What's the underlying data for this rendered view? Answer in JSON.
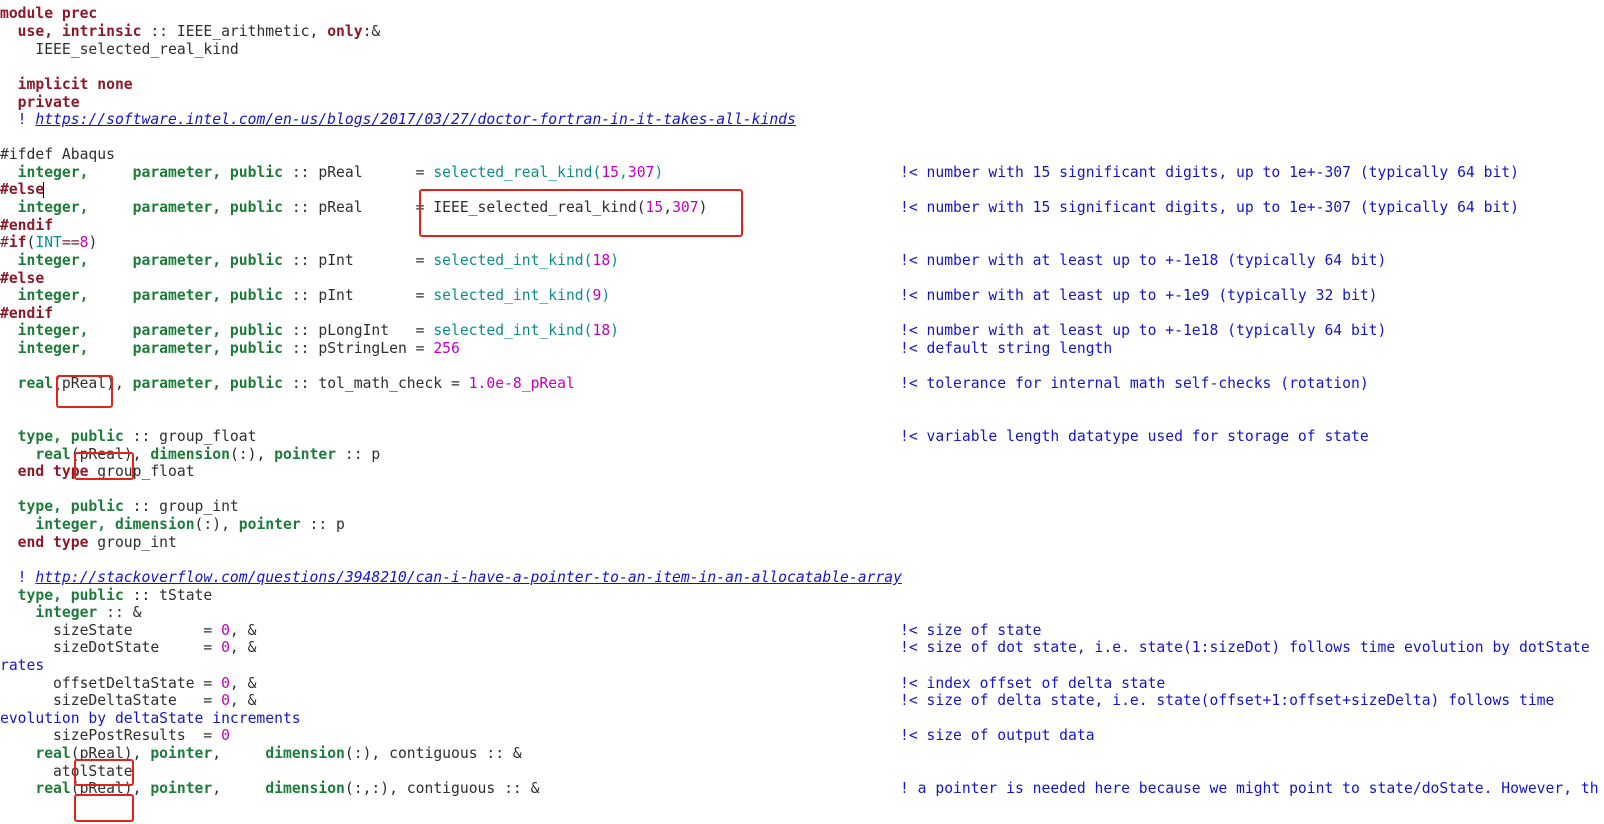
{
  "editor": {
    "lines": {
      "l01": "module prec",
      "l02a": "  use, intrinsic",
      "l02b": " :: IEEE_arithmetic, ",
      "l02c": "only",
      "l02d": ":&",
      "l03": "    IEEE_selected_real_kind",
      "l05": "  implicit none",
      "l06": "  private",
      "l07a": "  ! ",
      "l07url": "https://software.intel.com/en-us/blogs/2017/03/27/doctor-fortran-in-it-takes-all-kinds",
      "l09": "#ifdef Abaqus",
      "l10a": "  integer,",
      "l10b": "     parameter, public",
      "l10c": " :: pReal      = ",
      "l10fn": "selected_real_kind(",
      "l10n1": "15",
      "l10s": ",",
      "l10n2": "307",
      "l10e": ")",
      "l10c2": "!< number with 15 significant digits, up to 1e+-307 (typically 64 bit)",
      "l11": "#else",
      "l12a": "  integer,",
      "l12b": "     parameter, public",
      "l12c": " :: pReal      = IEEE_selected_real_kind(",
      "l12n1": "15",
      "l12s": ",",
      "l12n2": "307",
      "l12e": ")",
      "l12c2": "!< number with 15 significant digits, up to 1e+-307 (typically 64 bit)",
      "l13": "#endif",
      "l14a": "#",
      "l14b": "if",
      "l14c": "(",
      "l14d": "INT",
      "l14e": "==",
      "l14f": "8",
      "l14g": ")",
      "l15a": "  integer,",
      "l15b": "     parameter, public",
      "l15c": " :: pInt       = ",
      "l15fn": "selected_int_kind(",
      "l15n": "18",
      "l15e": ")",
      "l15c2": "!< number with at least up to +-1e18 (typically 64 bit)",
      "l16": "#else",
      "l17a": "  integer,",
      "l17b": "     parameter, public",
      "l17c": " :: pInt       = ",
      "l17fn": "selected_int_kind(",
      "l17n": "9",
      "l17e": ")",
      "l17c2": "!< number with at least up to +-1e9 (typically 32 bit)",
      "l18": "#endif",
      "l19a": "  integer,",
      "l19b": "     parameter, public",
      "l19c": " :: pLongInt   = ",
      "l19fn": "selected_int_kind(",
      "l19n": "18",
      "l19e": ")",
      "l19c2": "!< number with at least up to +-1e18 (typically 64 bit)",
      "l20a": "  integer,",
      "l20b": "     parameter, public",
      "l20c": " :: pStringLen = ",
      "l20n": "256",
      "l20c2": "!< default string length",
      "l22a": "  real",
      "l22b": "(pReal), ",
      "l22c": "parameter, public",
      "l22d": " :: tol_math_check = ",
      "l22n": "1.0e-8_pReal",
      "l22c2": "!< tolerance for internal math self-checks (rotation)",
      "l25a": "  type, public",
      "l25b": " :: group_float",
      "l25c2": "!< variable length datatype used for storage of state",
      "l26a": "    real",
      "l26b": "(pReal), ",
      "l26c": "dimension",
      "l26d": "(:), ",
      "l26e": "pointer",
      "l26f": " :: p",
      "l27a": "  end type",
      "l27b": " group_float",
      "l29a": "  type, public",
      "l29b": " :: group_int",
      "l30a": "    integer, dimension",
      "l30b": "(:), ",
      "l30c": "pointer",
      "l30d": " :: p",
      "l31a": "  end type",
      "l31b": " group_int",
      "l33a": "  ! ",
      "l33url": "http://stackoverflow.com/questions/3948210/can-i-have-a-pointer-to-an-item-in-an-allocatable-array",
      "l34a": "  type, public",
      "l34b": " :: tState",
      "l35a": "    integer",
      "l35b": " :: &",
      "l36a": "      sizeState        = ",
      "l36n": "0",
      "l36b": ", &",
      "l36c2": "!< size of state",
      "l37a": "      sizeDotState     = ",
      "l37n": "0",
      "l37b": ", &",
      "l37c2": "!< size of dot state, i.e. state(1:sizeDot) follows time evolution by dotState",
      "l38": "rates",
      "l39a": "      offsetDeltaState = ",
      "l39n": "0",
      "l39b": ", &",
      "l39c2": "!< index offset of delta state",
      "l40a": "      sizeDeltaState   = ",
      "l40n": "0",
      "l40b": ", &",
      "l40c2": "!< size of delta state, i.e. state(offset+1:offset+sizeDelta) follows time",
      "l41": "evolution by deltaState increments",
      "l42a": "      sizePostResults  = ",
      "l42n": "0",
      "l42c2": "!< size of output data",
      "l43a": "    real",
      "l43b": "(pReal), ",
      "l43c": "pointer",
      "l43d": ",     ",
      "l43e": "dimension",
      "l43f": "(:), contiguous :: &",
      "l44": "      atolState",
      "l45a": "    real",
      "l45b": "(pReal), ",
      "l45c": "pointer",
      "l45d": ",     ",
      "l45e": "dimension",
      "l45f": "(:,:), contiguous :: &",
      "l45c2": "! a pointer is needed here because we might point to state/doState. However, th"
    },
    "highlight_color": "#e2231a"
  }
}
